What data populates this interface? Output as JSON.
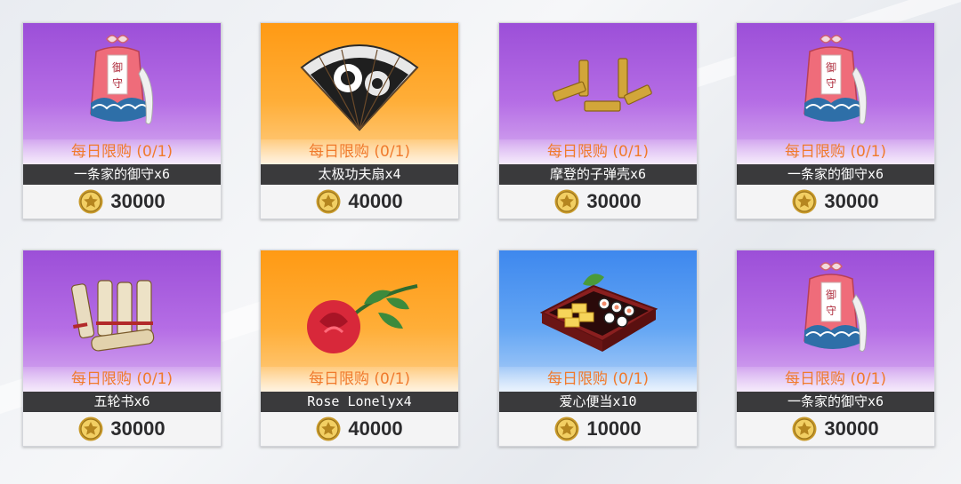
{
  "shop": {
    "items": [
      {
        "limit": "每日限购 (0/1)",
        "name": "一条家的御守x6",
        "price": "30000",
        "bg": "purple",
        "icon": "omamori-icon"
      },
      {
        "limit": "每日限购 (0/1)",
        "name": "太极功夫扇x4",
        "price": "40000",
        "bg": "orange",
        "icon": "taiji-fan-icon"
      },
      {
        "limit": "每日限购 (0/1)",
        "name": "摩登的子弹壳x6",
        "price": "30000",
        "bg": "purple",
        "icon": "bullet-shells-icon"
      },
      {
        "limit": "每日限购 (0/1)",
        "name": "一条家的御守x6",
        "price": "30000",
        "bg": "purple",
        "icon": "omamori-icon"
      },
      {
        "limit": "每日限购 (0/1)",
        "name": "五轮书x6",
        "price": "30000",
        "bg": "purple",
        "icon": "scrolls-icon"
      },
      {
        "limit": "每日限购 (0/1)",
        "name": "Rose Lonelyx4",
        "price": "40000",
        "bg": "orange",
        "icon": "rose-icon"
      },
      {
        "limit": "每日限购 (0/1)",
        "name": "爱心便当x10",
        "price": "10000",
        "bg": "blue",
        "icon": "bento-icon"
      },
      {
        "limit": "每日限购 (0/1)",
        "name": "一条家的御守x6",
        "price": "30000",
        "bg": "purple",
        "icon": "omamori-icon"
      }
    ],
    "omamori_char1": "御",
    "omamori_char2": "守",
    "colors": {
      "purple": "#a85ce0",
      "orange": "#ffa020",
      "blue": "#4a92f0",
      "limit_text": "#f07a2c",
      "name_bar": "#3a3a3c"
    }
  }
}
